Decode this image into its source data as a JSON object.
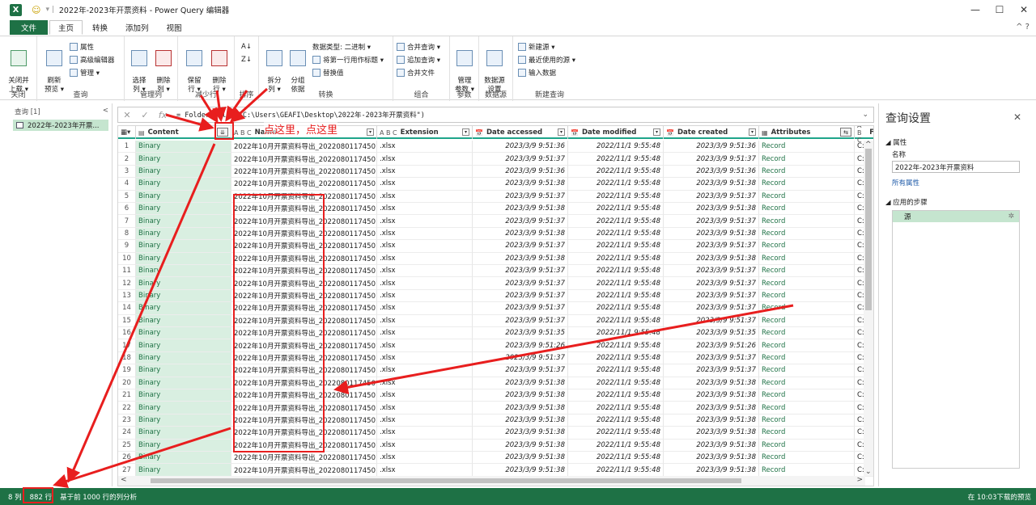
{
  "window": {
    "app_icon": "X",
    "title": "2022年-2023年开票资料 - Power Query 编辑器",
    "controls": [
      "—",
      "☐",
      "✕"
    ]
  },
  "ribbon_tabs": [
    "文件",
    "主页",
    "转换",
    "添加列",
    "视图"
  ],
  "ribbon": {
    "close": {
      "close_load": "关闭并\n上载 ▾",
      "label": "关闭"
    },
    "query": {
      "refresh": "刷新\n预览 ▾",
      "properties": "属性",
      "advanced": "高级编辑器",
      "manage": "管理 ▾",
      "label": "查询"
    },
    "manage_cols": {
      "choose": "选择\n列 ▾",
      "remove": "删除\n列 ▾",
      "label": "管理列"
    },
    "reduce_rows": {
      "keep": "保留\n行 ▾",
      "remove": "删除\n行 ▾",
      "label": "减少行"
    },
    "sort": {
      "label": "排序"
    },
    "transform": {
      "split": "拆分\n列 ▾",
      "group": "分组\n依据",
      "datatype": "数据类型: 二进制 ▾",
      "first_row": "将第一行用作标题 ▾",
      "replace": "替换值",
      "label": "转换"
    },
    "combine": {
      "merge": "合并查询 ▾",
      "append": "追加查询 ▾",
      "combine_files": "合并文件",
      "label": "组合"
    },
    "params": {
      "manage": "管理\n参数 ▾",
      "label": "参数"
    },
    "datasource": {
      "settings": "数据源\n设置",
      "label": "数据源"
    },
    "newquery": {
      "new_source": "新建源 ▾",
      "recent": "最近使用的源 ▾",
      "enter": "输入数据",
      "label": "新建查询"
    }
  },
  "left_pane": {
    "header": "查询 [1]",
    "collapse": "<",
    "item": "2022年-2023年开票..."
  },
  "formula": {
    "cancel": "✕",
    "ok": "✓",
    "fx": "fx",
    "text": "= Folder.Files(\"C:\\Users\\GEAFI\\Desktop\\2022年-2023年开票资料\")",
    "expand": "⌄"
  },
  "columns": [
    {
      "type": "▤",
      "name": "Content"
    },
    {
      "type": "A B C",
      "name": "Name"
    },
    {
      "type": "A B C",
      "name": "Extension"
    },
    {
      "type": "📅",
      "name": "Date accessed"
    },
    {
      "type": "📅",
      "name": "Date modified"
    },
    {
      "type": "📅",
      "name": "Date created"
    },
    {
      "type": "▦",
      "name": "Attributes"
    },
    {
      "type": "A B C",
      "name": "F"
    }
  ],
  "expand_button": "⇊",
  "rows": [
    {
      "n": "1",
      "content": "Binary",
      "name": "2022年10月开票资料导出_20220801174501 ...",
      "ext": ".xlsx",
      "da": "2023/3/9 9:51:36",
      "dm": "2022/11/1 9:55:48",
      "dc": "2023/3/9 9:51:36",
      "attr": "Record",
      "path": "C:\\"
    },
    {
      "n": "2",
      "content": "Binary",
      "name": "2022年10月开票资料导出_20220801174501 ...",
      "ext": ".xlsx",
      "da": "2023/3/9 9:51:37",
      "dm": "2022/11/1 9:55:48",
      "dc": "2023/3/9 9:51:37",
      "attr": "Record",
      "path": "C:\\"
    },
    {
      "n": "3",
      "content": "Binary",
      "name": "2022年10月开票资料导出_20220801174501 ...",
      "ext": ".xlsx",
      "da": "2023/3/9 9:51:36",
      "dm": "2022/11/1 9:55:48",
      "dc": "2023/3/9 9:51:36",
      "attr": "Record",
      "path": "C:\\"
    },
    {
      "n": "4",
      "content": "Binary",
      "name": "2022年10月开票资料导出_20220801174501 ...",
      "ext": ".xlsx",
      "da": "2023/3/9 9:51:38",
      "dm": "2022/11/1 9:55:48",
      "dc": "2023/3/9 9:51:38",
      "attr": "Record",
      "path": "C:\\"
    },
    {
      "n": "5",
      "content": "Binary",
      "name": "2022年10月开票资料导出_20220801174501 ...",
      "ext": ".xlsx",
      "da": "2023/3/9 9:51:37",
      "dm": "2022/11/1 9:55:48",
      "dc": "2023/3/9 9:51:37",
      "attr": "Record",
      "path": "C:\\"
    },
    {
      "n": "6",
      "content": "Binary",
      "name": "2022年10月开票资料导出_20220801174501 ...",
      "ext": ".xlsx",
      "da": "2023/3/9 9:51:38",
      "dm": "2022/11/1 9:55:48",
      "dc": "2023/3/9 9:51:38",
      "attr": "Record",
      "path": "C:\\"
    },
    {
      "n": "7",
      "content": "Binary",
      "name": "2022年10月开票资料导出_20220801174501 ...",
      "ext": ".xlsx",
      "da": "2023/3/9 9:51:37",
      "dm": "2022/11/1 9:55:48",
      "dc": "2023/3/9 9:51:37",
      "attr": "Record",
      "path": "C:\\"
    },
    {
      "n": "8",
      "content": "Binary",
      "name": "2022年10月开票资料导出_20220801174501 ...",
      "ext": ".xlsx",
      "da": "2023/3/9 9:51:38",
      "dm": "2022/11/1 9:55:48",
      "dc": "2023/3/9 9:51:38",
      "attr": "Record",
      "path": "C:\\"
    },
    {
      "n": "9",
      "content": "Binary",
      "name": "2022年10月开票资料导出_20220801174501 ...",
      "ext": ".xlsx",
      "da": "2023/3/9 9:51:37",
      "dm": "2022/11/1 9:55:48",
      "dc": "2023/3/9 9:51:37",
      "attr": "Record",
      "path": "C:\\"
    },
    {
      "n": "10",
      "content": "Binary",
      "name": "2022年10月开票资料导出_20220801174501 ...",
      "ext": ".xlsx",
      "da": "2023/3/9 9:51:38",
      "dm": "2022/11/1 9:55:48",
      "dc": "2023/3/9 9:51:38",
      "attr": "Record",
      "path": "C:\\"
    },
    {
      "n": "11",
      "content": "Binary",
      "name": "2022年10月开票资料导出_20220801174501 ...",
      "ext": ".xlsx",
      "da": "2023/3/9 9:51:37",
      "dm": "2022/11/1 9:55:48",
      "dc": "2023/3/9 9:51:37",
      "attr": "Record",
      "path": "C:\\"
    },
    {
      "n": "12",
      "content": "Binary",
      "name": "2022年10月开票资料导出_20220801174501 ...",
      "ext": ".xlsx",
      "da": "2023/3/9 9:51:37",
      "dm": "2022/11/1 9:55:48",
      "dc": "2023/3/9 9:51:37",
      "attr": "Record",
      "path": "C:\\"
    },
    {
      "n": "13",
      "content": "Binary",
      "name": "2022年10月开票资料导出_20220801174501 ...",
      "ext": ".xlsx",
      "da": "2023/3/9 9:51:37",
      "dm": "2022/11/1 9:55:48",
      "dc": "2023/3/9 9:51:37",
      "attr": "Record",
      "path": "C:\\"
    },
    {
      "n": "14",
      "content": "Binary",
      "name": "2022年10月开票资料导出_20220801174501 ...",
      "ext": ".xlsx",
      "da": "2023/3/9 9:51:37",
      "dm": "2022/11/1 9:55:48",
      "dc": "2023/3/9 9:51:37",
      "attr": "Record",
      "path": "C:\\"
    },
    {
      "n": "15",
      "content": "Binary",
      "name": "2022年10月开票资料导出_20220801174501 ...",
      "ext": ".xlsx",
      "da": "2023/3/9 9:51:37",
      "dm": "2022/11/1 9:55:48",
      "dc": "2023/3/9 9:51:37",
      "attr": "Record",
      "path": "C:\\"
    },
    {
      "n": "16",
      "content": "Binary",
      "name": "2022年10月开票资料导出_20220801174501 ...",
      "ext": ".xlsx",
      "da": "2023/3/9 9:51:35",
      "dm": "2022/11/1 9:55:48",
      "dc": "2023/3/9 9:51:35",
      "attr": "Record",
      "path": "C:\\"
    },
    {
      "n": "17",
      "content": "Binary",
      "name": "2022年10月开票资料导出_20220801174501 ...",
      "ext": ".xlsx",
      "da": "2023/3/9 9:51:26",
      "dm": "2022/11/1 9:55:48",
      "dc": "2023/3/9 9:51:26",
      "attr": "Record",
      "path": "C:\\"
    },
    {
      "n": "18",
      "content": "Binary",
      "name": "2022年10月开票资料导出_20220801174501 ...",
      "ext": ".xlsx",
      "da": "2023/3/9 9:51:37",
      "dm": "2022/11/1 9:55:48",
      "dc": "2023/3/9 9:51:37",
      "attr": "Record",
      "path": "C:\\"
    },
    {
      "n": "19",
      "content": "Binary",
      "name": "2022年10月开票资料导出_20220801174501 ...",
      "ext": ".xlsx",
      "da": "2023/3/9 9:51:37",
      "dm": "2022/11/1 9:55:48",
      "dc": "2023/3/9 9:51:37",
      "attr": "Record",
      "path": "C:\\"
    },
    {
      "n": "20",
      "content": "Binary",
      "name": "2022年10月开票资料导出_20220801174501 ...",
      "ext": ".xlsx",
      "da": "2023/3/9 9:51:38",
      "dm": "2022/11/1 9:55:48",
      "dc": "2023/3/9 9:51:38",
      "attr": "Record",
      "path": "C:\\"
    },
    {
      "n": "21",
      "content": "Binary",
      "name": "2022年10月开票资料导出_20220801174501 ...",
      "ext": ".xlsx",
      "da": "2023/3/9 9:51:38",
      "dm": "2022/11/1 9:55:48",
      "dc": "2023/3/9 9:51:38",
      "attr": "Record",
      "path": "C:\\"
    },
    {
      "n": "22",
      "content": "Binary",
      "name": "2022年10月开票资料导出_20220801174501 ...",
      "ext": ".xlsx",
      "da": "2023/3/9 9:51:38",
      "dm": "2022/11/1 9:55:48",
      "dc": "2023/3/9 9:51:38",
      "attr": "Record",
      "path": "C:\\"
    },
    {
      "n": "23",
      "content": "Binary",
      "name": "2022年10月开票资料导出_20220801174501 ...",
      "ext": ".xlsx",
      "da": "2023/3/9 9:51:38",
      "dm": "2022/11/1 9:55:48",
      "dc": "2023/3/9 9:51:38",
      "attr": "Record",
      "path": "C:\\"
    },
    {
      "n": "24",
      "content": "Binary",
      "name": "2022年10月开票资料导出_20220801174501 ...",
      "ext": ".xlsx",
      "da": "2023/3/9 9:51:38",
      "dm": "2022/11/1 9:55:48",
      "dc": "2023/3/9 9:51:38",
      "attr": "Record",
      "path": "C:\\"
    },
    {
      "n": "25",
      "content": "Binary",
      "name": "2022年10月开票资料导出_20220801174501 ...",
      "ext": ".xlsx",
      "da": "2023/3/9 9:51:38",
      "dm": "2022/11/1 9:55:48",
      "dc": "2023/3/9 9:51:38",
      "attr": "Record",
      "path": "C:\\"
    },
    {
      "n": "26",
      "content": "Binary",
      "name": "2022年10月开票资料导出_20220801174501 ...",
      "ext": ".xlsx",
      "da": "2023/3/9 9:51:38",
      "dm": "2022/11/1 9:55:48",
      "dc": "2023/3/9 9:51:38",
      "attr": "Record",
      "path": "C:\\"
    },
    {
      "n": "27",
      "content": "Binary",
      "name": "2022年10月开票资料导出_20220801174501 ...",
      "ext": ".xlsx",
      "da": "2023/3/9 9:51:38",
      "dm": "2022/11/1 9:55:48",
      "dc": "2023/3/9 9:51:38",
      "attr": "Record",
      "path": "C:\\"
    },
    {
      "n": "28",
      "content": "",
      "name": "",
      "ext": "",
      "da": "",
      "dm": "",
      "dc": "",
      "attr": "",
      "path": ""
    }
  ],
  "right_pane": {
    "title": "查询设置",
    "close": "✕",
    "properties": "◢ 属性",
    "name_label": "名称",
    "name_value": "2022年-2023年开票资料",
    "all_props": "所有属性",
    "applied_steps": "◢ 应用的步骤",
    "step": "源",
    "gear": "✲"
  },
  "status": {
    "cols": "8 列",
    "rows": "882 行",
    "basis": "基于前 1000 行的列分析",
    "right": "在 10:03下载的预览"
  },
  "annotation": {
    "text": "点这里，点这里"
  },
  "colors": {
    "excel_green": "#1e7145",
    "highlight_green": "#d9efe1",
    "annotation_red": "#e81e1e"
  }
}
